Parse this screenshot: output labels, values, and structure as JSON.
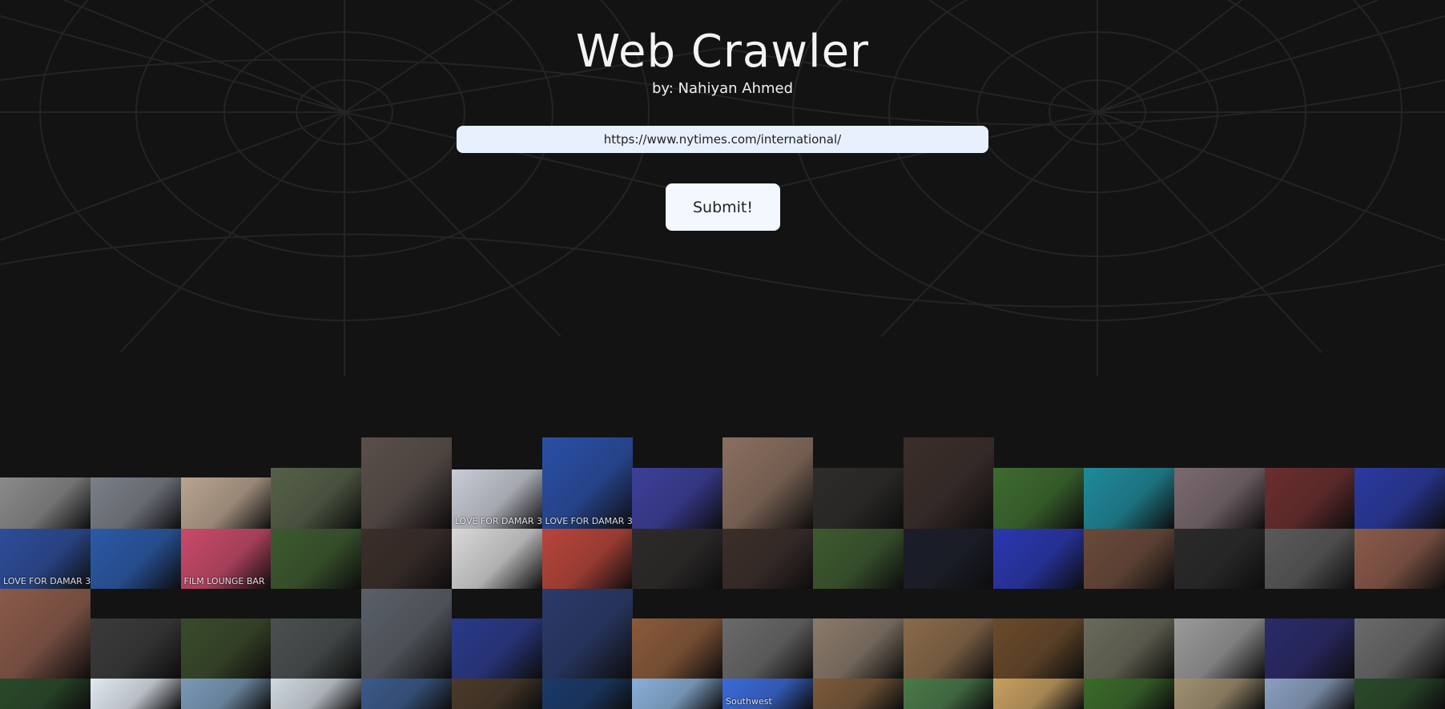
{
  "header": {
    "title": "Web Crawler",
    "subtitle": "by: Nahiyan Ahmed"
  },
  "form": {
    "url_value": "https://www.nytimes.com/international/",
    "submit_label": "Submit!"
  },
  "colors": {
    "background": "#131313",
    "input_bg": "#e8f0fe",
    "button_bg": "#f3f8ff",
    "web_lines": "#262626"
  },
  "gallery": {
    "image_labels": [
      "LOVE FOR DAMAR 3",
      "LOVE FOR DAMAR 3",
      "FILM LOUNGE BAR",
      "LOVE FOR DAMAR 3",
      "Southwest"
    ],
    "rows": [
      [
        {
          "color": "#8a8a8a"
        },
        {
          "color": "#7a8088"
        },
        {
          "color": "#b9a48f"
        },
        {
          "color": "#556048"
        },
        {
          "color": "#5a4f4a"
        },
        {
          "color": "#c9ccd6",
          "label_index": 0
        },
        {
          "color": "#2a4fa6",
          "label_index": 1
        },
        {
          "color": "#3c3f9a"
        },
        {
          "color": "#8a6f5f"
        },
        {
          "color": "#2e2c2a"
        },
        {
          "color": "#3b2e2a"
        },
        {
          "color": "#3d6b2f"
        },
        {
          "color": "#1f8a9a"
        },
        {
          "color": "#7a6a70"
        },
        {
          "color": "#6b2e2e"
        },
        {
          "color": "#2a3aa0"
        }
      ],
      [
        {
          "color": "#2d4d9a",
          "label_index": 3
        },
        {
          "color": "#2a5aa8"
        },
        {
          "color": "#c94a6a",
          "label_index": 2
        },
        {
          "color": "#3d5a2f"
        },
        {
          "color": "#3b2e2a"
        },
        {
          "color": "#d8d8d8"
        },
        {
          "color": "#b8453a"
        },
        {
          "color": "#2e2a2a"
        },
        {
          "color": "#3b2e2a"
        },
        {
          "color": "#3d5a2f"
        },
        {
          "color": "#1b1e2a"
        },
        {
          "color": "#2a37b0"
        },
        {
          "color": "#6a4a3a"
        },
        {
          "color": "#2a2a2a"
        },
        {
          "color": "#5a5a5a"
        },
        {
          "color": "#8a5a4a"
        }
      ],
      [
        {
          "color": "#8a5a4a"
        },
        {
          "color": "#3a3a3a"
        },
        {
          "color": "#3a4a2a"
        },
        {
          "color": "#4a5050"
        },
        {
          "color": "#5a6068"
        },
        {
          "color": "#2a3a8a"
        },
        {
          "color": "#2a3a6a"
        },
        {
          "color": "#8a5a3a"
        },
        {
          "color": "#6a6a6a"
        },
        {
          "color": "#8a7a6a"
        },
        {
          "color": "#8a6a4a"
        },
        {
          "color": "#6a4a2a"
        },
        {
          "color": "#6a6a5a"
        },
        {
          "color": "#9a9a9a"
        },
        {
          "color": "#2a2a6a"
        },
        {
          "color": "#6a6a6a"
        }
      ],
      [
        {
          "color": "#2a4a2a"
        },
        {
          "color": "#e0e8f0"
        },
        {
          "color": "#7a9ab8"
        },
        {
          "color": "#d0d8e0"
        },
        {
          "color": "#3a5a8a"
        },
        {
          "color": "#4a3a2a"
        },
        {
          "color": "#1a3a6a"
        },
        {
          "color": "#8ab0d8"
        },
        {
          "color": "#3a6ad8",
          "label_index": 4
        },
        {
          "color": "#7a5a3a"
        },
        {
          "color": "#4a7a4a"
        },
        {
          "color": "#c8a060"
        },
        {
          "color": "#3a6a2a"
        },
        {
          "color": "#a09070"
        },
        {
          "color": "#8aa0c0"
        },
        {
          "color": "#2a4a2a"
        }
      ]
    ]
  }
}
